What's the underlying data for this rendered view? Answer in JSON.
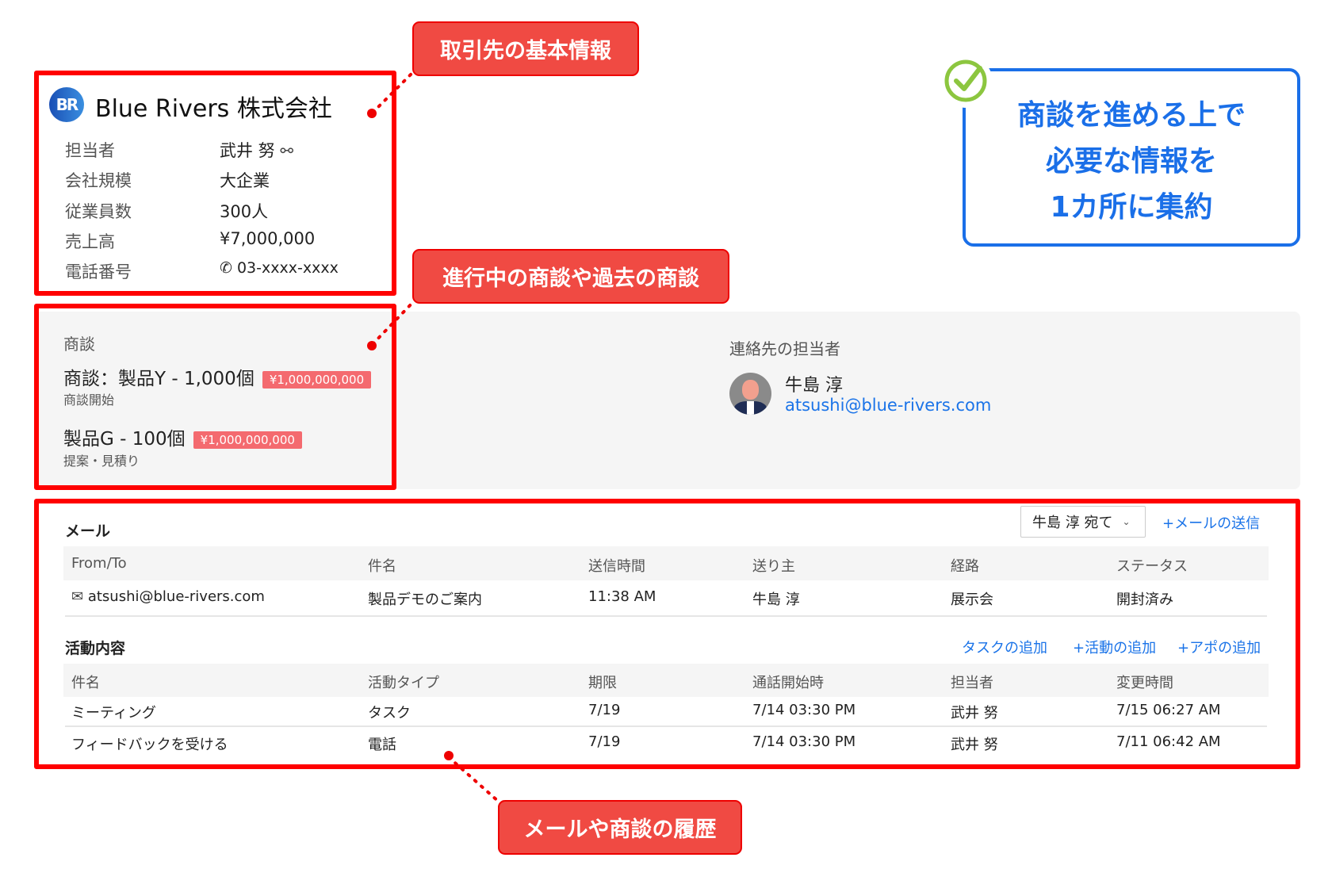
{
  "callouts": {
    "basic_info": "取引先の基本情報",
    "deals": "進行中の商談や過去の商談",
    "history": "メールや商談の履歴"
  },
  "highlight": {
    "lines": [
      "商談を進める上で",
      "必要な情報を",
      "1カ所に集約"
    ],
    "color": "#1a6fe8",
    "check_color": "#8cc63f"
  },
  "account": {
    "name": "Blue Rivers 株式会社",
    "logo_text": "BR",
    "fields": [
      {
        "label": "担当者",
        "value": "武井 努",
        "icon": "user-search-icon"
      },
      {
        "label": "会社規模",
        "value": "大企業"
      },
      {
        "label": "従業員数",
        "value": "300人"
      },
      {
        "label": "売上高",
        "value": "¥7,000,000"
      },
      {
        "label": "電話番号",
        "value": "03-xxxx-xxxx",
        "icon": "phone-icon"
      }
    ]
  },
  "deals": {
    "title": "商談",
    "items": [
      {
        "name": "商談：製品Y - 1,000個",
        "amount": "¥1,000,000,000",
        "stage": "商談開始"
      },
      {
        "name": "製品G - 100個",
        "amount": "¥1,000,000,000",
        "stage": "提案・見積り"
      }
    ]
  },
  "contact": {
    "title": "連絡先の担当者",
    "name": "牛島 淳",
    "email": "atsushi@blue-rivers.com"
  },
  "mail": {
    "title": "メール",
    "recipient_select": "牛島 淳 宛て",
    "send_link": "+メールの送信",
    "columns": [
      "From/To",
      "件名",
      "送信時間",
      "送り主",
      "経路",
      "ステータス"
    ],
    "rows": [
      [
        "atsushi@blue-rivers.com",
        "製品デモのご案内",
        "11:38 AM",
        "牛島 淳",
        "展示会",
        "開封済み"
      ]
    ]
  },
  "activities": {
    "title": "活動内容",
    "actions": [
      "タスクの追加",
      "+活動の追加",
      "+アポの追加"
    ],
    "columns": [
      "件名",
      "活動タイプ",
      "期限",
      "通話開始時",
      "担当者",
      "変更時間"
    ],
    "rows": [
      [
        "ミーティング",
        "タスク",
        "7/19",
        "7/14 03:30 PM",
        "武井 努",
        "7/15 06:27 AM"
      ],
      [
        "フィードバックを受ける",
        "電話",
        "7/19",
        "7/14 03:30 PM",
        "武井 努",
        "7/11 06:42 AM"
      ]
    ]
  },
  "colors": {
    "annotation_red": "#ff0000",
    "callout_fill": "#f04a43",
    "link_blue": "#1a73e8",
    "badge": "#f46a6f"
  }
}
